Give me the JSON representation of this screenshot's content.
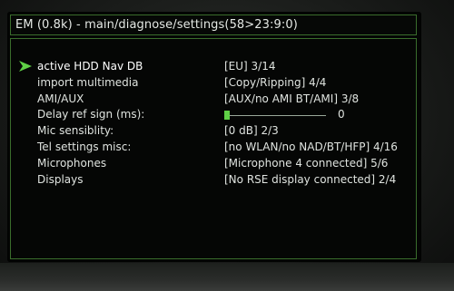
{
  "title": "EM (0.8k) - main/diagnose/settings(58>23:9:0)",
  "items": [
    {
      "label": "active HDD Nav DB",
      "value": "[EU] 3/14",
      "selected": true
    },
    {
      "label": "import multimedia",
      "value": "[Copy/Ripping] 4/4"
    },
    {
      "label": "AMI/AUX",
      "value": "[AUX/no AMI BT/AMI] 3/8"
    },
    {
      "label": "Delay ref sign (ms):",
      "value": "0",
      "slider_level": 0
    },
    {
      "label": "Mic sensiblity:",
      "value": "[0 dB] 2/3"
    },
    {
      "label": "Tel settings misc:",
      "value": "[no WLAN/no NAD/BT/HFP] 4/16"
    },
    {
      "label": "Microphones",
      "value": "[Microphone 4 connected] 5/6"
    },
    {
      "label": "Displays",
      "value": "[No RSE display connected] 2/4"
    }
  ],
  "colors": {
    "accent_green": "#5fd046",
    "frame_green": "#3a6d2c",
    "text": "#dfe3df"
  },
  "icons": {
    "cursor": "selection-arrow-icon"
  }
}
